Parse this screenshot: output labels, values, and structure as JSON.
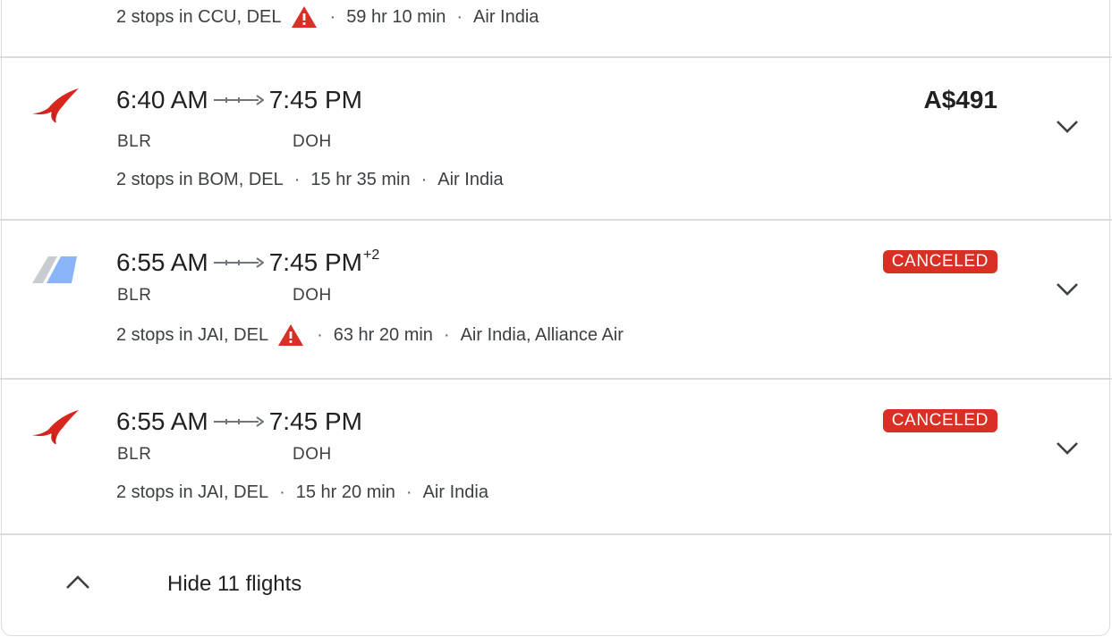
{
  "top_row": {
    "details": "2 stops in CCU, DEL",
    "duration": "59 hr 10 min",
    "airline": "Air India",
    "has_warning": true
  },
  "flights": [
    {
      "depart": "6:40 AM",
      "arrive": "7:45 PM",
      "day_offset": "",
      "from": "BLR",
      "to": "DOH",
      "stops": "2 stops in BOM, DEL",
      "duration": "15 hr 35 min",
      "airline": "Air India",
      "price": "A$491",
      "logo": "air-india-logo"
    },
    {
      "depart": "6:55 AM",
      "arrive": "7:45 PM",
      "day_offset": "+2",
      "from": "BLR",
      "to": "DOH",
      "stops": "2 stops in JAI, DEL",
      "duration": "63 hr 20 min",
      "airline": "Air India, Alliance Air",
      "status": "CANCELED",
      "logo": "multi-airline-logo"
    },
    {
      "depart": "6:55 AM",
      "arrive": "7:45 PM",
      "day_offset": "",
      "from": "BLR",
      "to": "DOH",
      "stops": "2 stops in JAI, DEL",
      "duration": "15 hr 20 min",
      "airline": "Air India",
      "status": "CANCELED",
      "logo": "air-india-logo"
    }
  ],
  "footer": {
    "label": "Hide 11 flights",
    "icon": "chevron-up-icon"
  },
  "colors": {
    "canceled": "#d93025",
    "warning": "#d93025",
    "divider": "#dadce0",
    "text_secondary": "#3c4043"
  }
}
